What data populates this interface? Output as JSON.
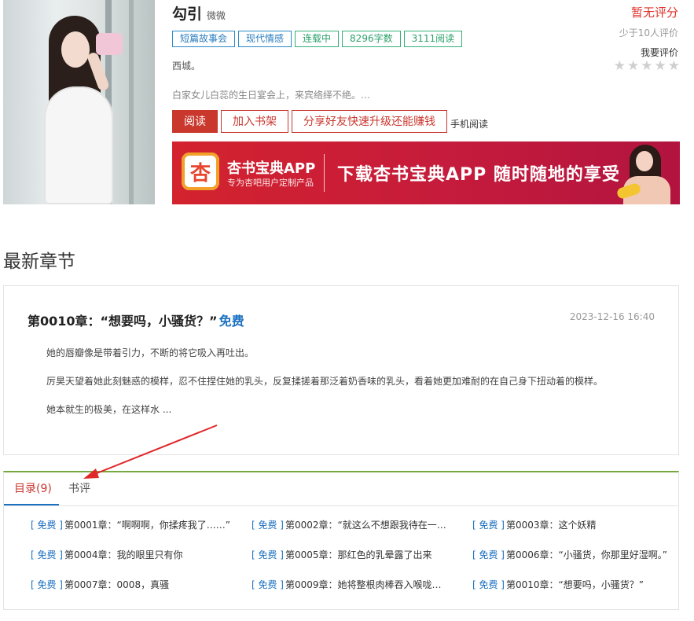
{
  "book": {
    "title": "勾引",
    "author": "微微",
    "score": "暂无评分",
    "rating_count": "少于10人评价",
    "rate_me": "我要评价",
    "stars_total": 5,
    "tags": [
      {
        "label": "短篇故事会",
        "style": "blue"
      },
      {
        "label": "现代情感",
        "style": "blue"
      },
      {
        "label": "连载中",
        "style": "green"
      },
      {
        "label": "8296字数",
        "style": "green"
      },
      {
        "label": "3111阅读",
        "style": "green"
      }
    ],
    "desc_line1": "西城。",
    "desc_line2": "白家女儿白蕊的生日宴会上，来宾络绎不绝。…"
  },
  "actions": {
    "read": "阅读",
    "add_shelf": "加入书架",
    "share": "分享好友快速升级还能赚钱",
    "mobile": "手机阅读"
  },
  "banner": {
    "logo_char": "杏",
    "app_name": "杏书宝典APP",
    "app_sub": "专为杏吧用户定制产品",
    "slogan": "下载杏书宝典APP 随时随地的享受"
  },
  "latest": {
    "section_title": "最新章节",
    "chapter_title": "第0010章：“想要吗，小骚货？”",
    "free_label": "免费",
    "date": "2023-12-16 16:40",
    "paragraphs": [
      "她的唇瓣像是带着引力，不断的将它吸入再吐出。",
      "厉昊天望着她此刻魅惑的模样，忍不住捏住她的乳头，反复揉搓着那泛着奶香味的乳头，看着她更加难耐的在自己身下扭动着的模样。",
      "她本就生的极美，在这样水 ..."
    ]
  },
  "tabs": {
    "toc": "目录(9)",
    "review": "书评"
  },
  "chapters": [
    {
      "tag": "[ 免费 ]",
      "title": "第0001章：“啊啊啊，你揉疼我了……”"
    },
    {
      "tag": "[ 免费 ]",
      "title": "第0002章：“就这么不想跟我待在一…"
    },
    {
      "tag": "[ 免费 ]",
      "title": "第0003章：这个妖精"
    },
    {
      "tag": "[ 免费 ]",
      "title": "第0004章：我的眼里只有你"
    },
    {
      "tag": "[ 免费 ]",
      "title": "第0005章：那红色的乳晕露了出来"
    },
    {
      "tag": "[ 免费 ]",
      "title": "第0006章：“小骚货，你那里好湿啊。”"
    },
    {
      "tag": "[ 免费 ]",
      "title": "第0007章：0008，真骚"
    },
    {
      "tag": "[ 免费 ]",
      "title": "第0009章：她将整根肉棒吞入喉咙…"
    },
    {
      "tag": "[ 免费 ]",
      "title": "第0010章：“想要吗，小骚货？”"
    }
  ]
}
